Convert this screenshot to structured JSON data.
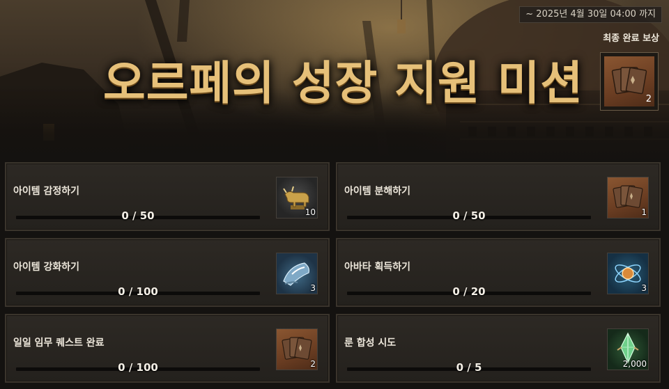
{
  "event": {
    "deadline": "~ 2025년 4월 30일 04:00 까지",
    "title": "오르페의 성장 지원 미션",
    "final_reward": {
      "label": "최종 완료 보상",
      "icon": "card-pack-icon",
      "quantity": "2"
    }
  },
  "missions": [
    {
      "name": "아이템 감정하기",
      "progress": "0 / 50",
      "fraction": 0,
      "reward": {
        "icon": "bull-statue-icon",
        "quantity": "10"
      }
    },
    {
      "name": "아이템 분해하기",
      "progress": "0 / 50",
      "fraction": 0,
      "reward": {
        "icon": "card-pack-icon",
        "quantity": "1"
      }
    },
    {
      "name": "아이템 강화하기",
      "progress": "0 / 100",
      "fraction": 0,
      "reward": {
        "icon": "enhance-stone-icon",
        "quantity": "3"
      }
    },
    {
      "name": "아바타 획득하기",
      "progress": "0 / 20",
      "fraction": 0,
      "reward": {
        "icon": "avatar-orb-icon",
        "quantity": "3"
      }
    },
    {
      "name": "일일 임무 퀘스트 완료",
      "progress": "0 / 100",
      "fraction": 0,
      "reward": {
        "icon": "card-pack-icon",
        "quantity": "2"
      }
    },
    {
      "name": "룬 합성 시도",
      "progress": "0 / 5",
      "fraction": 0,
      "reward": {
        "icon": "rune-crystal-icon",
        "quantity": "2,000"
      }
    }
  ],
  "colors": {
    "title_gold": "#e6c079",
    "progress_fill": "#c9a56a",
    "card_bg": "#2d2924",
    "card_border": "#3a342c"
  }
}
